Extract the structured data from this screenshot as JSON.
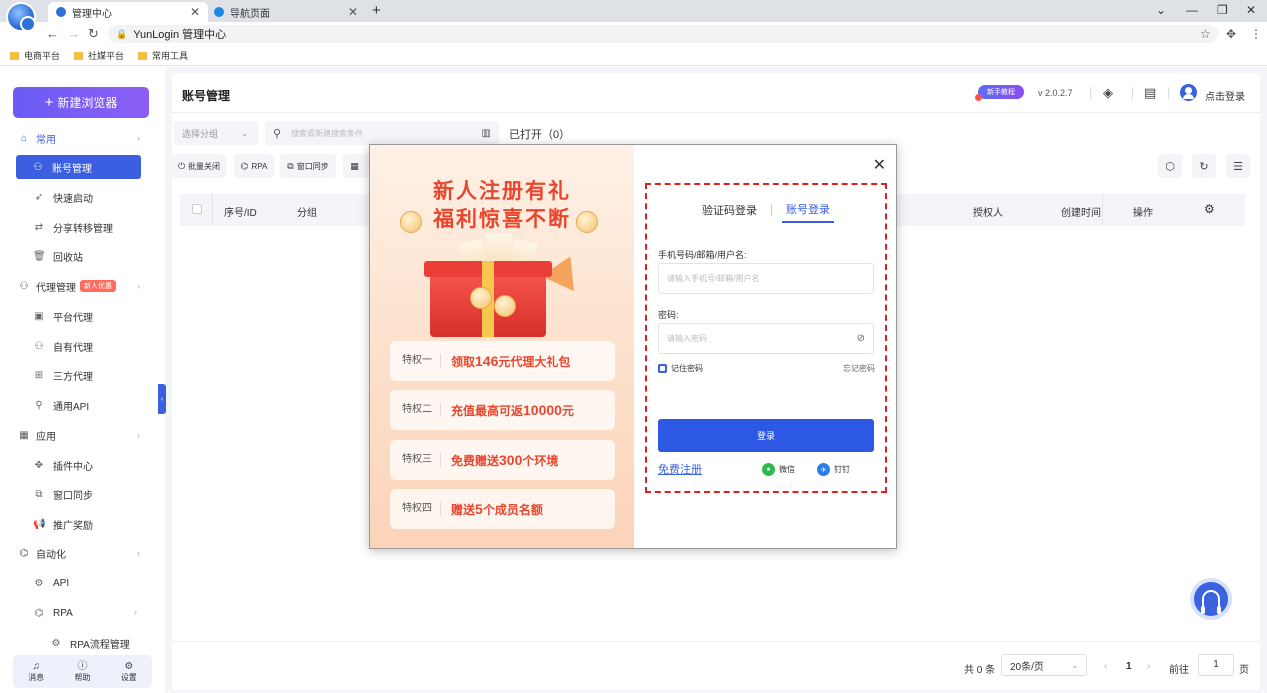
{
  "browser": {
    "tabs": [
      {
        "title": "管理中心",
        "active": true,
        "color": "#2f6fd8"
      },
      {
        "title": "导航页面",
        "active": false,
        "color": "#1e88e5"
      }
    ],
    "address": "YunLogin 管理中心",
    "bookmarks": [
      "电商平台",
      "社媒平台",
      "常用工具"
    ]
  },
  "sidebar": {
    "new_browser": "新建浏览器",
    "groups": [
      {
        "label": "常用",
        "icon": "home-icon"
      },
      {
        "label": "代理管理",
        "icon": "proxy-icon",
        "badge": "新人优惠"
      },
      {
        "label": "应用",
        "icon": "apps-icon"
      },
      {
        "label": "自动化",
        "icon": "robot-icon"
      }
    ],
    "items": {
      "account": "账号管理",
      "quick": "快速启动",
      "transfer": "分享转移管理",
      "recycle": "回收站",
      "platform_proxy": "平台代理",
      "own_proxy": "自有代理",
      "third_proxy": "三方代理",
      "api_proxy": "通用API",
      "plugins": "插件中心",
      "window_sync": "窗口同步",
      "promotion": "推广奖励",
      "api": "API",
      "rpa": "RPA",
      "rpa_flow": "RPA流程管理"
    },
    "bottom": {
      "messages": "消息",
      "help": "帮助",
      "settings": "设置"
    }
  },
  "header": {
    "title": "账号管理",
    "tutorial": "新手教程",
    "version": "v 2.0.2.7",
    "login": "点击登录"
  },
  "filters": {
    "group_placeholder": "选择分组",
    "search_placeholder": "搜索或新建搜索条件",
    "opened": "已打开（0）"
  },
  "toolbar": {
    "batch_close": "批量关闭",
    "rpa": "RPA",
    "window_sync": "窗口同步"
  },
  "table": {
    "columns": [
      "序号/ID",
      "分组",
      "授权人",
      "创建时间",
      "操作"
    ]
  },
  "pager": {
    "total": "共 0 条",
    "page_size": "20条/页",
    "current": "1",
    "goto": "前往",
    "goto_value": "1",
    "page": "页"
  },
  "modal": {
    "promo_title_1": "新人注册有礼",
    "promo_title_2": "福利惊喜不断",
    "perks": [
      {
        "label": "特权一",
        "pre": "领取",
        "num": "146",
        "post": "元代理大礼包"
      },
      {
        "label": "特权二",
        "pre": "充值最高可返",
        "num": "10000",
        "post": "元"
      },
      {
        "label": "特权三",
        "pre": "免费赠送",
        "num": "300",
        "post": "个环境"
      },
      {
        "label": "特权四",
        "pre": "赠送",
        "num": "5",
        "post": "个成员名额"
      }
    ],
    "tab_code": "验证码登录",
    "tab_account": "账号登录",
    "username_label": "手机号码/邮箱/用户名:",
    "username_placeholder": "请输入手机号/邮箱/用户名",
    "password_label": "密码:",
    "password_placeholder": "请输入密码",
    "remember": "记住密码",
    "forgot": "忘记密码",
    "submit": "登录",
    "register": "免费注册",
    "wechat": "微信",
    "dingtalk": "钉钉"
  },
  "colors": {
    "primary": "#3b5fe0",
    "accent": "#e8472f",
    "highlight_border": "#e02020"
  }
}
